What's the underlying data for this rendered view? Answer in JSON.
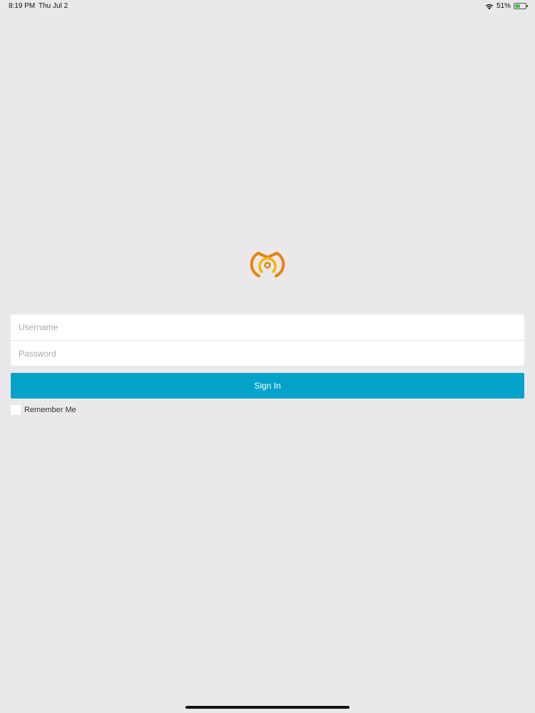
{
  "status_bar": {
    "time": "8:19 PM",
    "date": "Thu Jul 2",
    "battery_text": "51%",
    "battery_level": 0.51,
    "icons": [
      "wifi-icon",
      "battery-icon"
    ]
  },
  "logo": {
    "icon": "app-logo-icon",
    "colors": {
      "outer": "#E8830E",
      "inner": "#F2B705"
    }
  },
  "login": {
    "username_placeholder": "Username",
    "password_placeholder": "Password",
    "sign_in_label": "Sign In",
    "remember_label": "Remember Me"
  },
  "colors": {
    "background": "#EAE8EB",
    "accent": "#03A3C9",
    "field_bg": "#FFFFFF"
  }
}
